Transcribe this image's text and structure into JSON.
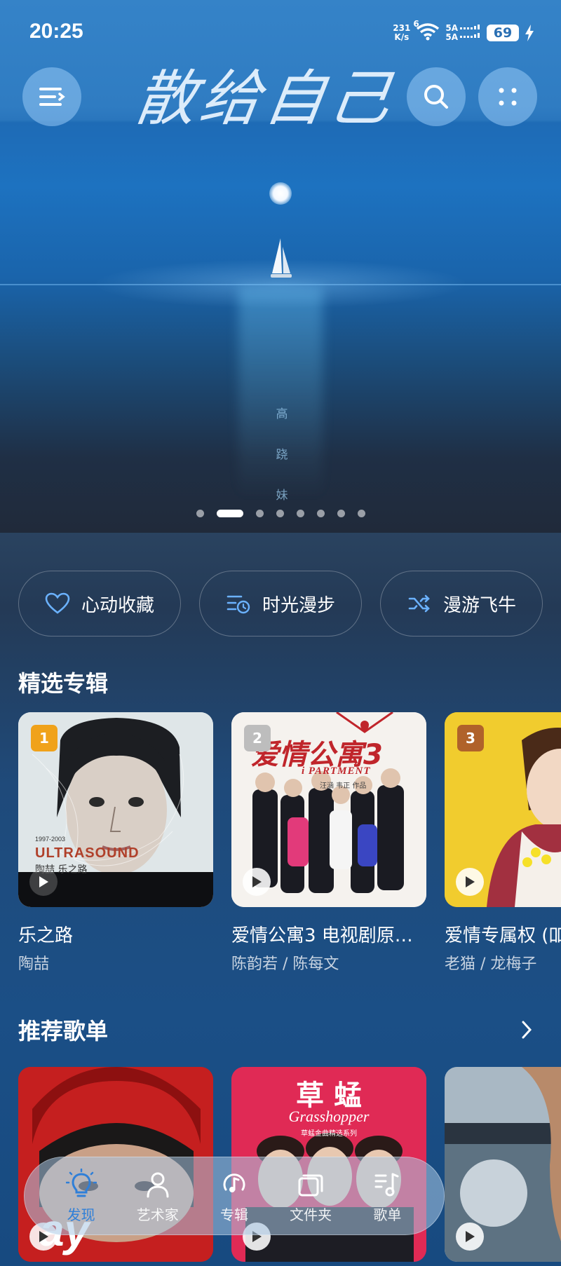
{
  "status_bar": {
    "time": "20:25",
    "net_speed_top": "231",
    "net_speed_unit": "K/s",
    "wifi_label": "6",
    "sim1": "5A",
    "sim2": "5A",
    "battery": "69"
  },
  "hero": {
    "calligraphy": "散给自己",
    "vertical_caption": [
      "高",
      "跷",
      "妹"
    ],
    "carousel_total": 8,
    "carousel_active": 2
  },
  "top_buttons": {
    "menu_icon": "menu-icon",
    "search_icon": "search-icon",
    "grid_icon": "more-dots-icon"
  },
  "chips": [
    {
      "label": "心动收藏",
      "icon": "heart-icon"
    },
    {
      "label": "时光漫步",
      "icon": "history-icon"
    },
    {
      "label": "漫游飞牛",
      "icon": "shuffle-icon"
    }
  ],
  "featured": {
    "title": "精选专辑",
    "albums": [
      {
        "rank": "1",
        "name": "乐之路",
        "artist": "陶喆",
        "cover_text": "ULTRASOUND",
        "cover_sub": "1997-2003",
        "cover_cn": "陶喆 乐之路"
      },
      {
        "rank": "2",
        "name": "爱情公寓3 电视剧原…",
        "artist": "陈韵若 / 陈每文",
        "cover_text": "爱情公寓3",
        "cover_sub": "i PARTMENT",
        "cover_cn": "汪涵 韦正 作品"
      },
      {
        "rank": "3",
        "name": "爱情专属权 (吅",
        "artist": "老猫 / 龙梅子"
      }
    ]
  },
  "playlists": {
    "title": "推荐歌单",
    "more_icon": "chevron-right-icon",
    "items": [
      {
        "cover_text": "ay"
      },
      {
        "cover_text": "草 蜢",
        "cover_sub": "Grasshopper",
        "cover_cn": "草蜢金曲精选系列"
      },
      {
        "cover_text": ""
      }
    ]
  },
  "bottom_nav": [
    {
      "label": "发现",
      "icon": "bulb-icon",
      "active": true
    },
    {
      "label": "艺术家",
      "icon": "person-icon",
      "active": false
    },
    {
      "label": "专辑",
      "icon": "album-icon",
      "active": false
    },
    {
      "label": "文件夹",
      "icon": "folder-icon",
      "active": false
    },
    {
      "label": "歌单",
      "icon": "playlist-icon",
      "active": false
    }
  ],
  "colors": {
    "rank1": "#f0a21a",
    "rank2": "#bdbdbd",
    "rank3": "#b0622a",
    "nav_active": "#2f7fd8"
  }
}
